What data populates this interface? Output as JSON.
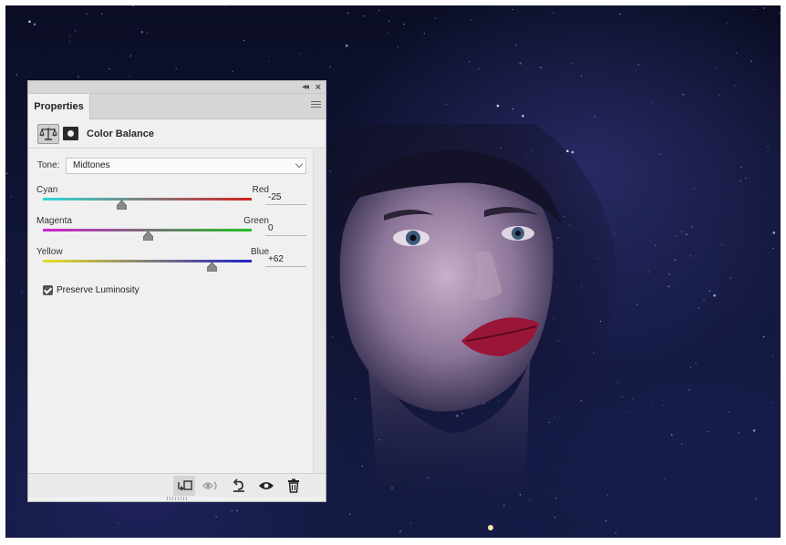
{
  "panel": {
    "tab_label": "Properties",
    "collapse_icon": "double-chevron-left-icon",
    "close_icon": "close-icon",
    "menu_icon": "hamburger-menu-icon"
  },
  "adjustment": {
    "title": "Color Balance",
    "icon": "balance-scale-icon",
    "mask_icon": "layer-mask-icon"
  },
  "tone": {
    "label": "Tone:",
    "selected": "Midtones"
  },
  "sliders": [
    {
      "left_label": "Cyan",
      "right_label": "Red",
      "value": -25,
      "value_text": "-25",
      "min": -100,
      "max": 100,
      "left_color": "#2dd8d8",
      "right_color": "#d42020"
    },
    {
      "left_label": "Magenta",
      "right_label": "Green",
      "value": 0,
      "value_text": "0",
      "min": -100,
      "max": 100,
      "left_color": "#d020d0",
      "right_color": "#20c020"
    },
    {
      "left_label": "Yellow",
      "right_label": "Blue",
      "value": 62,
      "value_text": "+62",
      "min": -100,
      "max": 100,
      "left_color": "#e8e020",
      "right_color": "#2020c8"
    }
  ],
  "preserve_luminosity": {
    "label": "Preserve Luminosity",
    "checked": true
  },
  "bottom_toolbar": [
    {
      "name": "clip-to-layer-icon"
    },
    {
      "name": "view-previous-state-icon"
    },
    {
      "name": "reset-icon"
    },
    {
      "name": "toggle-visibility-icon"
    },
    {
      "name": "delete-icon"
    }
  ]
}
